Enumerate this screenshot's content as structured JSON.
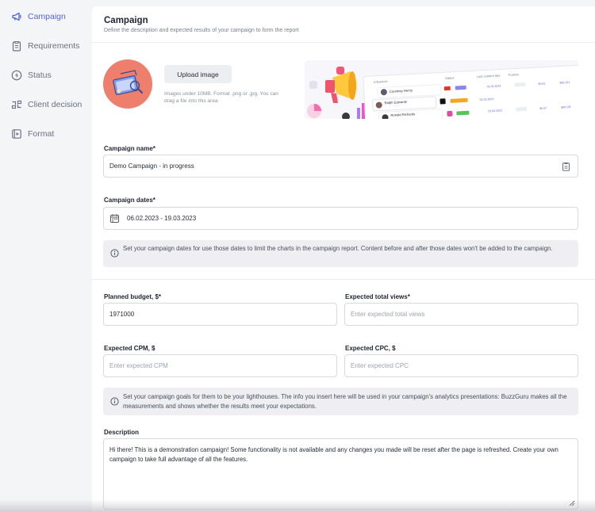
{
  "sidebar": {
    "items": [
      {
        "label": "Campaign",
        "icon": "megaphone-icon"
      },
      {
        "label": "Requirements",
        "icon": "clipboard-icon"
      },
      {
        "label": "Status",
        "icon": "bolt-icon"
      },
      {
        "label": "Client decision",
        "icon": "decision-icon"
      },
      {
        "label": "Format",
        "icon": "play-square-icon"
      }
    ],
    "active_color": "#5566d6"
  },
  "header": {
    "title": "Campaign",
    "subtitle": "Define the description and expected results of your campaign to form the report"
  },
  "image_upload": {
    "button_label": "Upload image",
    "hint": "Images under 10MB. Format .png or .jpg. You can drag a file into this area",
    "avatar_color": "#ee7f6d"
  },
  "preview": {
    "columns": [
      "Influencer",
      "Status",
      "Last content day",
      "Format"
    ],
    "rows": [
      {
        "name": "Courtney Henry",
        "status_color": "#8b87e8",
        "date": "01.03.2023",
        "cpm": "$0.81",
        "cpc": "$00.101"
      },
      {
        "name": "Ralph Edwards",
        "status_color": "#f5a623",
        "date": "02.03.2023",
        "cpm": "$0.65",
        "cpc": "$00.101"
      },
      {
        "name": "Ronald Richards",
        "status_color": "#5bc25b",
        "date": "03.03.2023",
        "cpm": "$0.47",
        "cpc": "$00.101"
      }
    ]
  },
  "campaign_name": {
    "label": "Campaign name*",
    "value": "Demo Campaign - in progress"
  },
  "campaign_dates": {
    "label": "Campaign dates*",
    "value": "06.02.2023 - 19.03.2023",
    "info": "Set your campaign dates for use those dates to limit the charts in the campaign report. Content before and after those dates won't be added to the campaign."
  },
  "budget": {
    "label": "Planned budget, $*",
    "value": "1971000"
  },
  "views": {
    "label": "Expected total views*",
    "placeholder": "Enter expected total views"
  },
  "cpm": {
    "label": "Expected CPM, $",
    "placeholder": "Enter expected CPM"
  },
  "cpc": {
    "label": "Expected CPC, $",
    "placeholder": "Enter expected CPC"
  },
  "goals_info": "Set your campaign goals for them to be your lighthouses. The info you insert here will be used in your campaign's analytics presentations: BuzzGuru makes all the measurements and shows whether the results meet your expectations.",
  "description": {
    "label": "Description",
    "value": "Hi there! This is a demonstration campaign! Some functionality is not available and any changes you made will be reset after the page is refreshed. Create your own campaign to take full advantage of all the features."
  }
}
